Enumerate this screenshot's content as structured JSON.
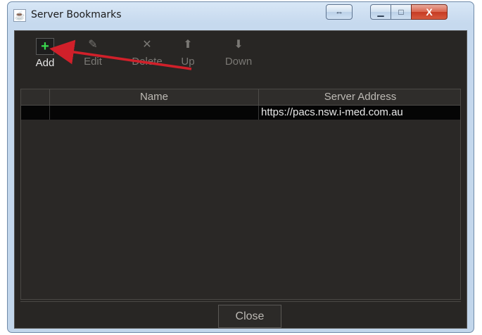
{
  "window": {
    "title": "Server Bookmarks",
    "close_glyph": "X"
  },
  "toolbar": {
    "add_label": "Add",
    "edit_label": "Edit",
    "delete_label": "Delete",
    "up_label": "Up",
    "down_label": "Down"
  },
  "table": {
    "columns": [
      "",
      "Name",
      "Server Address"
    ],
    "rows": [
      {
        "name": "",
        "address": "https://pacs.nsw.i-med.com.au"
      }
    ]
  },
  "footer": {
    "close_label": "Close"
  },
  "colors": {
    "accent_add": "#39d84d",
    "annotation_arrow": "#d0202a"
  }
}
